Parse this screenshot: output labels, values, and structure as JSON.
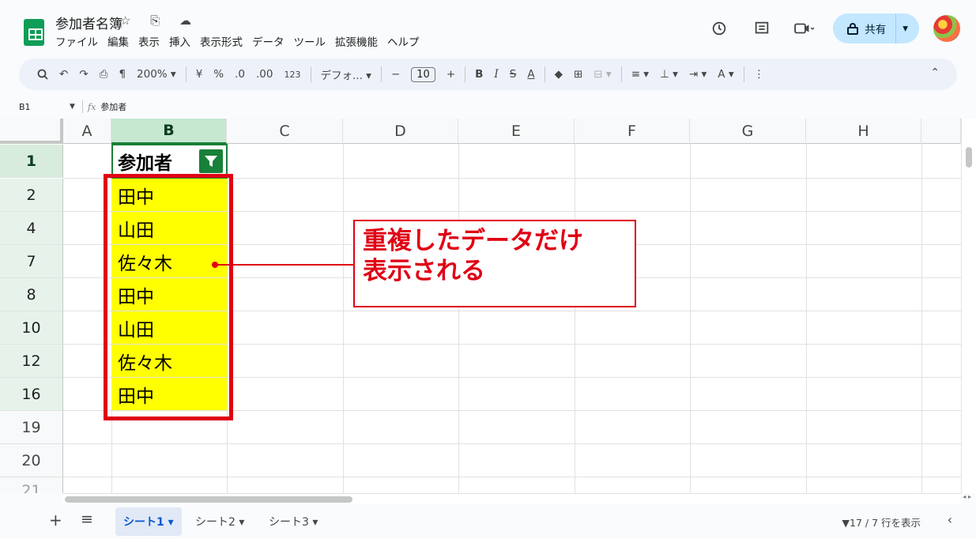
{
  "app": {
    "doc_title": "参加者名簿",
    "title_icons": "☆ ⎘ ☁",
    "menu": [
      "ファイル",
      "編集",
      "表示",
      "挿入",
      "表示形式",
      "データ",
      "ツール",
      "拡張機能",
      "ヘルプ"
    ],
    "share_label": "共有",
    "top_icons": [
      "history-icon",
      "comment-icon",
      "video-call-icon"
    ]
  },
  "toolbar": {
    "search": "🔍",
    "undo": "↶",
    "redo": "↷",
    "print": "⎙",
    "paint_format": "¶",
    "zoom": "200% ▾",
    "currency": "¥",
    "percent": "%",
    "dec_decrease": ".0",
    "dec_increase": ".00",
    "number_format": "123",
    "font": "デフォ... ▾",
    "font_minus": "−",
    "font_size": "10",
    "font_plus": "+",
    "bold": "B",
    "italic": "I",
    "strike": "S",
    "text_color": "A",
    "fill": "◆",
    "borders": "⊞",
    "merge": "⊟ ▾",
    "halign": "≡ ▾",
    "valign": "⊥ ▾",
    "wrap": "⇥ ▾",
    "rotate": "A ▾",
    "more": "⋮",
    "collapse": "⌃"
  },
  "formula_bar": {
    "cell_ref": "B1",
    "caret": "▼",
    "fx": "fx",
    "content": "参加者"
  },
  "columns": [
    "A",
    "B",
    "C",
    "D",
    "E",
    "F",
    "G",
    "H"
  ],
  "rows": [
    {
      "num": "1",
      "b": "参加者"
    },
    {
      "num": "2",
      "b": "田中"
    },
    {
      "num": "4",
      "b": "山田"
    },
    {
      "num": "7",
      "b": "佐々木"
    },
    {
      "num": "8",
      "b": "田中"
    },
    {
      "num": "10",
      "b": "山田"
    },
    {
      "num": "12",
      "b": "佐々木"
    },
    {
      "num": "16",
      "b": "田中"
    },
    {
      "num": "19",
      "b": ""
    },
    {
      "num": "20",
      "b": ""
    }
  ],
  "callout": {
    "line1": "重複したデータだけ",
    "line2": "表示される"
  },
  "colors": {
    "highlight": "#ffff00",
    "annotation": "#e00014",
    "selection": "#1a7f37"
  },
  "tabs": {
    "add": "+",
    "menu": "≡",
    "sheets": [
      {
        "label": "シート1 ▾",
        "active": true
      },
      {
        "label": "シート2 ▾",
        "active": false
      },
      {
        "label": "シート3 ▾",
        "active": false
      }
    ],
    "filter_status": "▼17 / 7 行を表示",
    "explore": "‹"
  }
}
